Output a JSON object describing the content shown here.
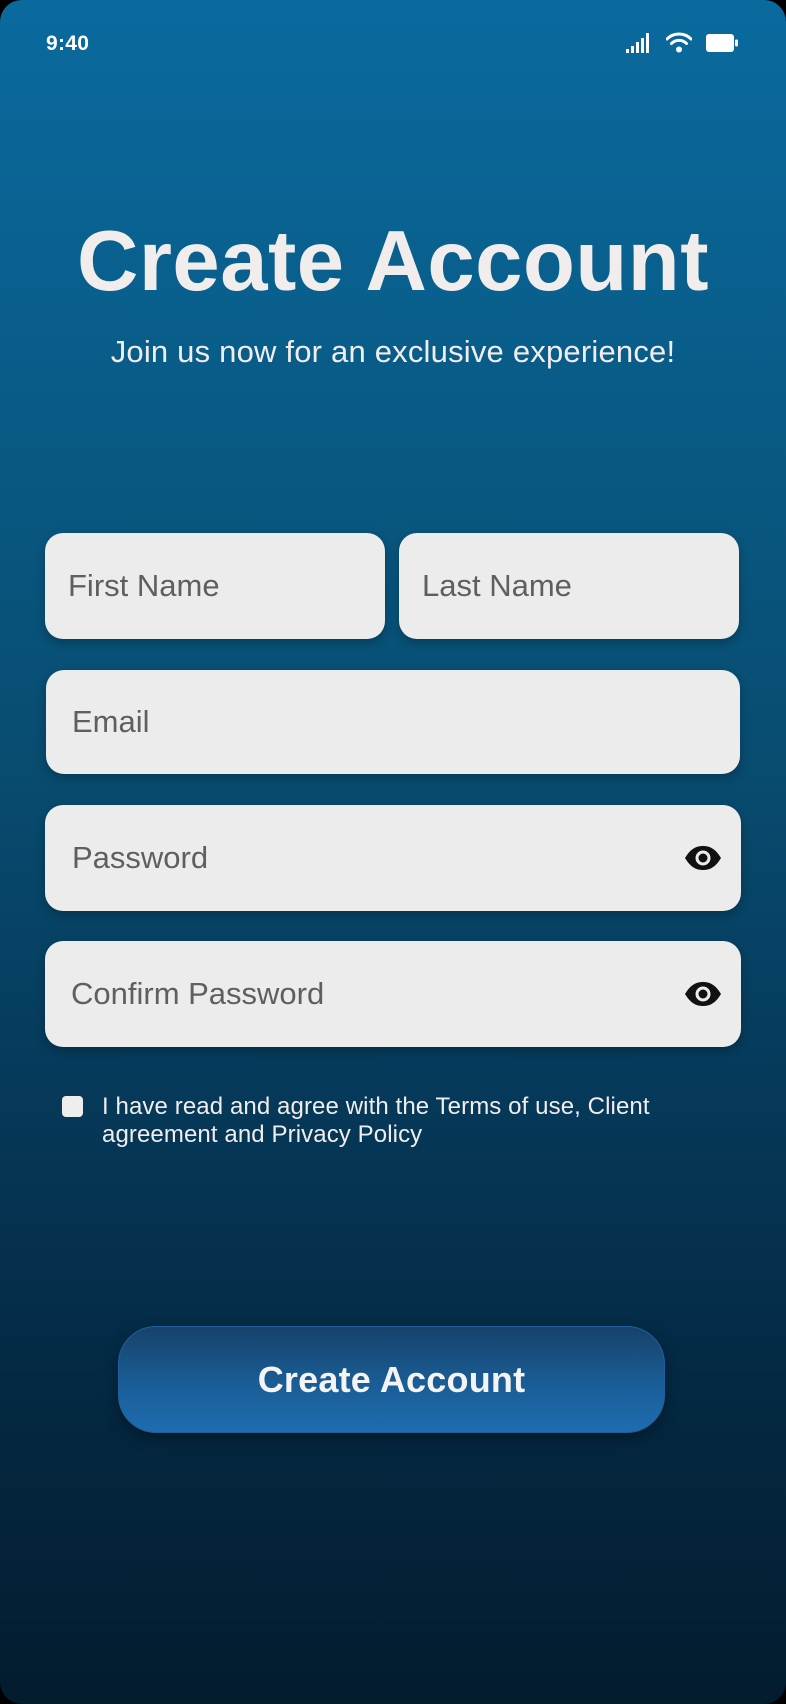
{
  "status_bar": {
    "time": "9:40",
    "icons": [
      "cellular-signal-icon",
      "wifi-icon",
      "battery-icon"
    ]
  },
  "header": {
    "title": "Create Account",
    "subtitle": "Join us now for an exclusive experience!"
  },
  "form": {
    "first_name": {
      "placeholder": "First Name",
      "value": ""
    },
    "last_name": {
      "placeholder": "Last Name",
      "value": ""
    },
    "email": {
      "placeholder": "Email",
      "value": ""
    },
    "password": {
      "placeholder": "Password",
      "value": "",
      "toggle_icon": "eye-icon"
    },
    "confirm_password": {
      "placeholder": "Confirm Password",
      "value": "",
      "toggle_icon": "eye-icon"
    },
    "terms": {
      "checked": false,
      "label": "I have read and agree with the Terms of use, Client agreement and Privacy Policy"
    },
    "submit_label": "Create Account"
  },
  "colors": {
    "background_top": "#0a6a9e",
    "background_bottom": "#031c2e",
    "field_background": "#ececec",
    "button_top": "#17426c",
    "button_bottom": "#1e6db0",
    "text_light": "#f2eded"
  }
}
